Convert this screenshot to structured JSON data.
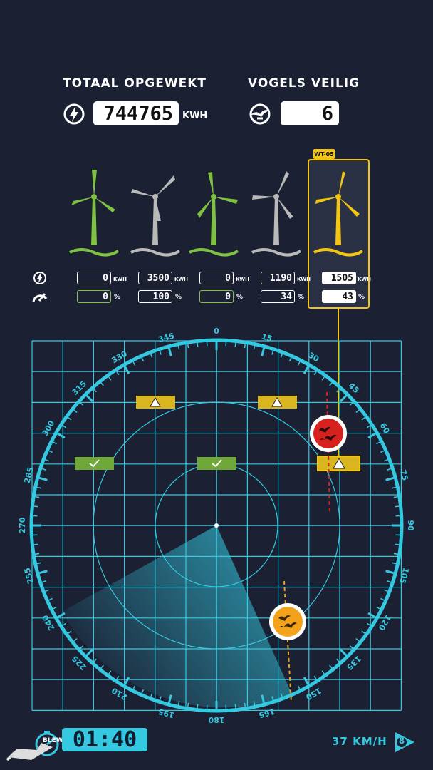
{
  "stats": {
    "total_label": "TOTAAL OPGEWEKT",
    "total_value": "744765",
    "total_unit": "KWH",
    "birds_label": "VOGELS VEILIG",
    "birds_value": "6"
  },
  "turbines": [
    {
      "power": "0",
      "percent": "0",
      "state": "green"
    },
    {
      "power": "3500",
      "percent": "100",
      "state": "grey"
    },
    {
      "power": "0",
      "percent": "0",
      "state": "green"
    },
    {
      "power": "1190",
      "percent": "34",
      "state": "grey"
    },
    {
      "power": "1505",
      "percent": "43",
      "state": "selected",
      "tag": "WT-05"
    }
  ],
  "units": {
    "power": "KWH",
    "percent": "%"
  },
  "radar": {
    "bearings": [
      "0",
      "15",
      "30",
      "45",
      "60",
      "75",
      "90",
      "105",
      "120",
      "135",
      "150",
      "165",
      "180",
      "195",
      "210",
      "225",
      "240",
      "255",
      "270",
      "285",
      "300",
      "315",
      "330",
      "345"
    ]
  },
  "footer": {
    "logo_text": "BLEWSCREEN",
    "timer": "01:40",
    "wind_speed": "37 KM/H",
    "wind_level": "8"
  },
  "colors": {
    "accent": "#34c9e0",
    "green": "#7fc241",
    "yellow": "#f3c613",
    "alert_red": "#d6211e",
    "alert_orange": "#f3a21c",
    "background": "#1b2033"
  }
}
